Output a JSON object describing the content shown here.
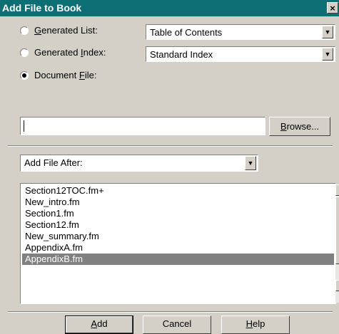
{
  "window": {
    "title": "Add File to Book",
    "close_glyph": "×"
  },
  "options": {
    "generated_list": {
      "prefix": "",
      "accel": "G",
      "suffix": "enerated List:",
      "checked": false
    },
    "generated_index": {
      "prefix": "Generated ",
      "accel": "I",
      "suffix": "ndex:",
      "checked": false
    },
    "document_file": {
      "prefix": "Document ",
      "accel": "F",
      "suffix": "ile:",
      "checked": true
    }
  },
  "list_select": {
    "value": "Table of Contents"
  },
  "index_select": {
    "value": "Standard Index"
  },
  "document_input": {
    "value": ""
  },
  "browse_button": {
    "accel": "B",
    "rest": "rowse..."
  },
  "position_select": {
    "value": "Add File After:"
  },
  "files": [
    "Section12TOC.fm+",
    "New_intro.fm",
    "Section1.fm",
    "Section12.fm",
    "New_summary.fm",
    "AppendixA.fm",
    "AppendixB.fm"
  ],
  "selected_file": "AppendixB.fm",
  "buttons": {
    "add": {
      "accel": "A",
      "rest": "dd"
    },
    "cancel": {
      "label": "Cancel"
    },
    "help": {
      "accel": "H",
      "rest": "elp"
    }
  },
  "icons": {
    "dropdown": "triangle-down",
    "scroll_up": "triangle-up",
    "scroll_down": "triangle-down",
    "close": "x"
  }
}
